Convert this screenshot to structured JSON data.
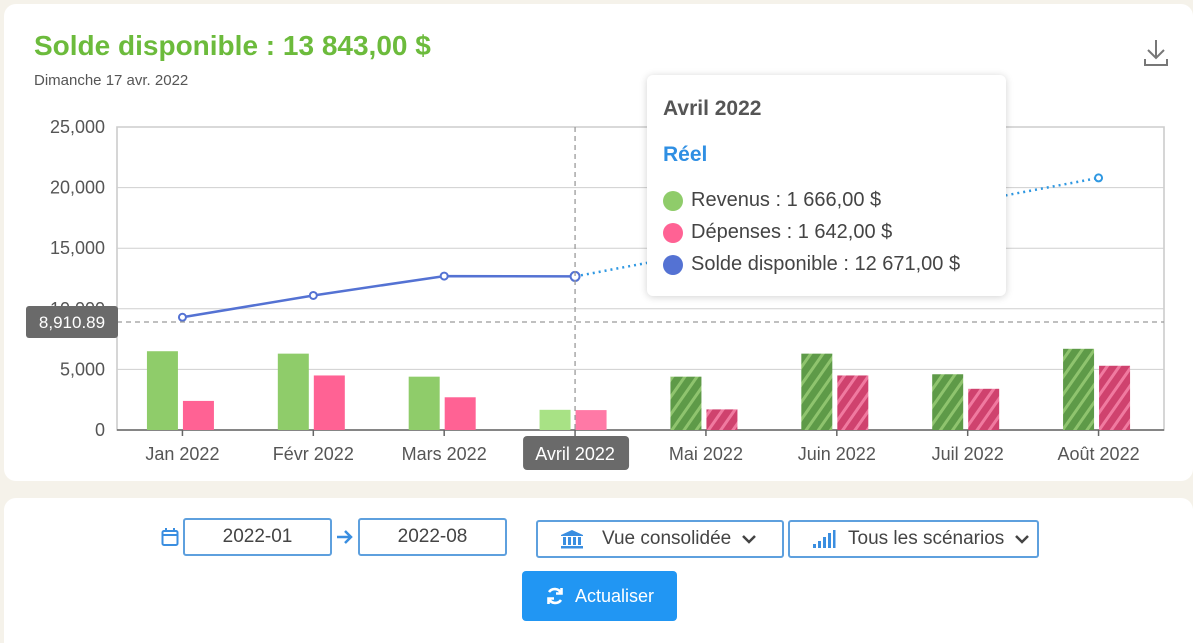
{
  "header": {
    "title": "Solde disponible : 13 843,00 $",
    "date": "Dimanche 17 avr. 2022",
    "download_icon": "download-icon"
  },
  "colors": {
    "revenus": "#8fcc6a",
    "revenus_forecast": "#5e9a48",
    "depenses": "#ff6294",
    "depenses_forecast": "#d0436f",
    "solde": "#5472d3",
    "solde_forecast": "#2f98e2",
    "title_green": "#6cbb3c",
    "accent_blue": "#2196f3"
  },
  "chart_data": {
    "type": "bar",
    "categories": [
      "Jan 2022",
      "Févr 2022",
      "Mars 2022",
      "Avril 2022",
      "Mai 2022",
      "Juin 2022",
      "Juil 2022",
      "Août 2022"
    ],
    "series": [
      {
        "name": "Revenus",
        "type": "bar",
        "values": [
          6500,
          6300,
          4400,
          1666,
          4400,
          6300,
          4600,
          6700
        ],
        "forecast_from_index": 4
      },
      {
        "name": "Dépenses",
        "type": "bar",
        "values": [
          2400,
          4500,
          2700,
          1642,
          1700,
          4500,
          3400,
          5300
        ],
        "forecast_from_index": 4
      },
      {
        "name": "Solde disponible",
        "type": "line",
        "values": [
          9300,
          11100,
          12700,
          12671,
          null,
          null,
          null,
          20800
        ],
        "forecast_from_index": 3
      }
    ],
    "ylim": [
      0,
      25000
    ],
    "yticks": [
      "0",
      "5,000",
      "10,000",
      "15,000",
      "20,000",
      "25,000"
    ],
    "reference_line": {
      "value": 8910.89,
      "label": "8,910.89"
    },
    "highlighted_category": "Avril 2022",
    "grid": true
  },
  "tooltip": {
    "title": "Avril 2022",
    "subtitle": "Réel",
    "rows": [
      {
        "label": "Revenus : 1 666,00 $",
        "color": "#8fcc6a"
      },
      {
        "label": "Dépenses : 1 642,00 $",
        "color": "#ff6294"
      },
      {
        "label": "Solde disponible : 12 671,00 $",
        "color": "#5472d3"
      }
    ]
  },
  "controls": {
    "date_from": "2022-01",
    "date_to": "2022-08",
    "view_select": "Vue consolidée",
    "scenario_select": "Tous les scénarios",
    "refresh_label": "Actualiser"
  }
}
